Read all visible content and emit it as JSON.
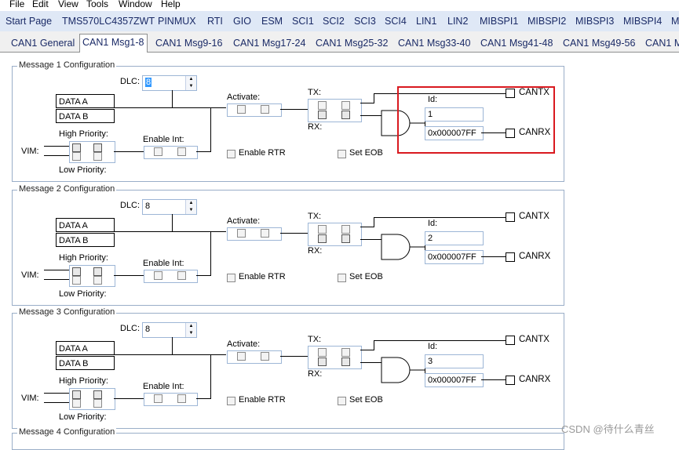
{
  "menu": [
    "File",
    "Edit",
    "View",
    "Tools",
    "Window",
    "Help"
  ],
  "top_tabs": [
    "Start Page",
    "TMS570LC4357ZWT",
    "PINMUX",
    "RTI",
    "GIO",
    "ESM",
    "SCI1",
    "SCI2",
    "SCI3",
    "SCI4",
    "LIN1",
    "LIN2",
    "MIBSPI1",
    "MIBSPI2",
    "MIBSPI3",
    "MIBSPI4",
    "M"
  ],
  "sub_tabs": [
    "CAN1 General",
    "CAN1 Msg1-8",
    "CAN1 Msg9-16",
    "CAN1 Msg17-24",
    "CAN1 Msg25-32",
    "CAN1 Msg33-40",
    "CAN1 Msg41-48",
    "CAN1 Msg49-56",
    "CAN1 M"
  ],
  "labels": {
    "dlc": "DLC:",
    "data_a": "DATA A",
    "data_b": "DATA B",
    "high_priority": "High Priority:",
    "low_priority": "Low Priority:",
    "vim": "VIM:",
    "enable_int": "Enable Int:",
    "activate": "Activate:",
    "enable_rtr": "Enable RTR",
    "set_eob": "Set EOB",
    "tx": "TX:",
    "rx": "RX:",
    "id": "Id:",
    "cantx": "CANTX",
    "canrx": "CANRX"
  },
  "messages": [
    {
      "title": "Message 1 Configuration",
      "dlc": "8",
      "id": "1",
      "mask": "0x000007FF"
    },
    {
      "title": "Message 2 Configuration",
      "dlc": "8",
      "id": "2",
      "mask": "0x000007FF"
    },
    {
      "title": "Message 3 Configuration",
      "dlc": "8",
      "id": "3",
      "mask": "0x000007FF"
    },
    {
      "title": "Message 4 Configuration"
    }
  ],
  "watermark": "CSDN @待什么青丝",
  "colors": {
    "highlight_box": "#d9191f",
    "tab_text": "#1a2a66",
    "group_border": "#9aaec8"
  }
}
